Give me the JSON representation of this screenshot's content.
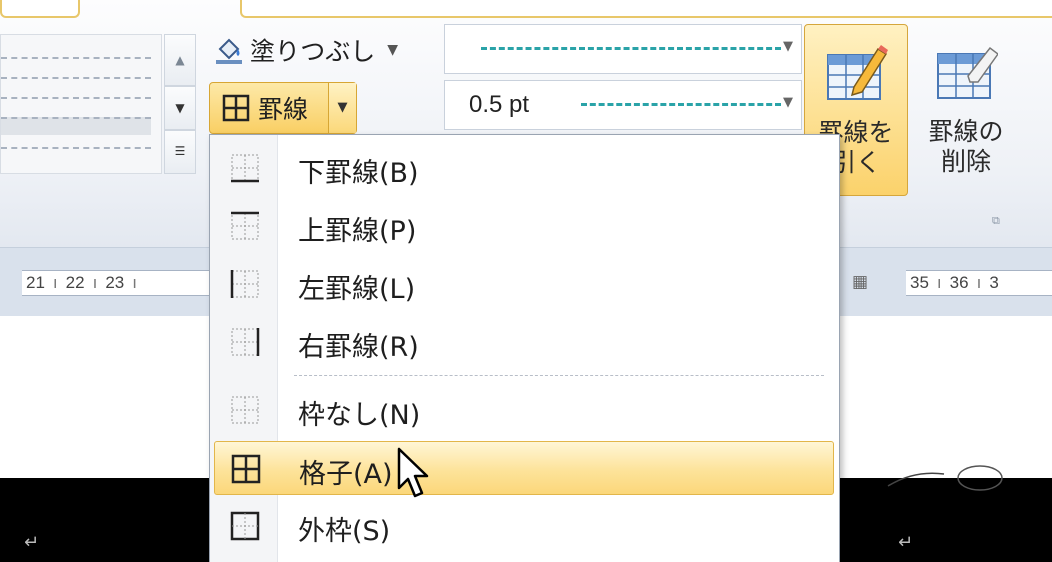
{
  "ribbon": {
    "shading_label": "塗りつぶし",
    "borders_label": "罫線",
    "line_weight": "0.5 pt",
    "draw_table_label_1": "罫線を",
    "draw_table_label_2": "引く",
    "eraser_label_1": "罫線の",
    "eraser_label_2": "削除",
    "accent_color": "#f9cf64",
    "pen_color": "#2aa3a8"
  },
  "ruler": {
    "left_numbers": [
      "21",
      "22",
      "23"
    ],
    "right_numbers": [
      "35",
      "36",
      "3"
    ]
  },
  "menu": {
    "items": [
      {
        "label": "下罫線(B)",
        "icon": "bottom-border-icon"
      },
      {
        "label": "上罫線(P)",
        "icon": "top-border-icon"
      },
      {
        "label": "左罫線(L)",
        "icon": "left-border-icon"
      },
      {
        "label": "右罫線(R)",
        "icon": "right-border-icon"
      },
      {
        "label": "枠なし(N)",
        "icon": "no-border-icon"
      },
      {
        "label": "格子(A)",
        "icon": "all-borders-icon",
        "highlighted": true
      },
      {
        "label": "外枠(S)",
        "icon": "outside-borders-icon"
      }
    ]
  }
}
